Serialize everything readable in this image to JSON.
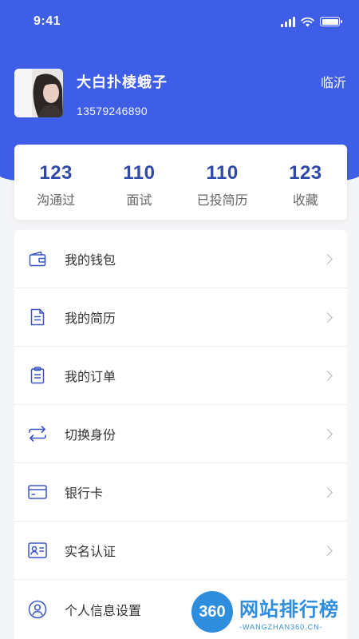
{
  "status_bar": {
    "time": "9:41"
  },
  "profile": {
    "name": "大白扑棱蛾子",
    "phone": "13579246890",
    "city": "临沂"
  },
  "stats": [
    {
      "value": "123",
      "label": "沟通过"
    },
    {
      "value": "110",
      "label": "面试"
    },
    {
      "value": "110",
      "label": "已投简历"
    },
    {
      "value": "123",
      "label": "收藏"
    }
  ],
  "menu": [
    {
      "label": "我的钱包",
      "icon": "wallet-icon"
    },
    {
      "label": "我的简历",
      "icon": "resume-icon"
    },
    {
      "label": "我的订单",
      "icon": "order-icon"
    },
    {
      "label": "切换身份",
      "icon": "switch-icon"
    },
    {
      "label": "银行卡",
      "icon": "bank-card-icon"
    },
    {
      "label": "实名认证",
      "icon": "id-card-icon"
    },
    {
      "label": "个人信息设置",
      "icon": "user-icon"
    }
  ],
  "watermark": {
    "badge": "360",
    "title": "网站排行榜",
    "subtitle": "-WANGZHAN360.CN-"
  },
  "colors": {
    "brand": "#3f5ee8",
    "stat_value": "#2f49a8",
    "icon": "#3a56c5"
  }
}
